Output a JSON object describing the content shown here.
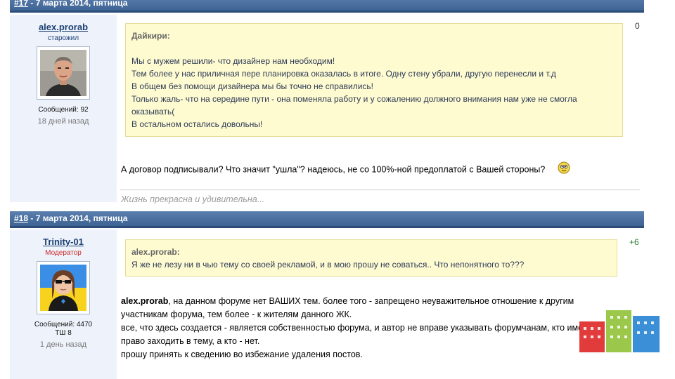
{
  "posts": [
    {
      "number": "#17",
      "date": " - 7 марта 2014, пятница",
      "author": "alex.prorab",
      "rank": "старожил",
      "messages": "Сообщений: 92",
      "extra": "",
      "last_seen": "18 дней назад",
      "rating": "0",
      "quote_author": "Дайкири:",
      "quote_lines": [
        "Мы с мужем решили- что дизайнер нам необходим!",
        "Тем более у нас приличная пере планировка оказалась в итоге. Одну стену убрали, другую перенесли и т.д",
        "В общем без помощи дизайнера мы бы точно не справились!",
        "Только жаль- что на середине пути - она поменяла работу и у сожалению должного внимания нам уже не смогла",
        "оказывать(",
        "В остальном остались довольны!"
      ],
      "text": "А договор подписывали? Что значит \"ушла\"? надеюсь, не со 100%-ной предоплатой с Вашей стороны?",
      "signature": "Жизнь прекрасна и удивительна..."
    },
    {
      "number": "#18",
      "date": " - 7 марта 2014, пятница",
      "author": "Trinity-01",
      "rank": "Модератор",
      "messages": "Сообщений: 4470",
      "extra": "ТШ 8",
      "last_seen": "1 день назад",
      "rating": "+6",
      "quote_author": "alex.prorab:",
      "quote_lines": [
        "Я же не лезу ни в чью тему со своей рекламой, и в мою прошу не соваться.. Что непонятного то???"
      ],
      "text_bold": "alex.prorab",
      "text_lines": [
        ", на данном форуме нет ВАШИХ тем. более того - запрещено неуважительное отношение к другим",
        "участникам форума, тем более - к жителям данного ЖК.",
        "все, что здесь создается - является собственностью форума, и автор не вправе указывать форумчанам, кто имеет",
        "право заходить в тему, а кто - нет.",
        "прошу принять к сведению во избежание удаления постов."
      ]
    }
  ],
  "colors": {
    "header": "#3e6494",
    "quote_bg": "#fffbd1",
    "author_bg": "#eef3fb",
    "rating_positive": "#2e7d32"
  },
  "icons": [
    "smiley-icon",
    "site-logo-buildings"
  ]
}
